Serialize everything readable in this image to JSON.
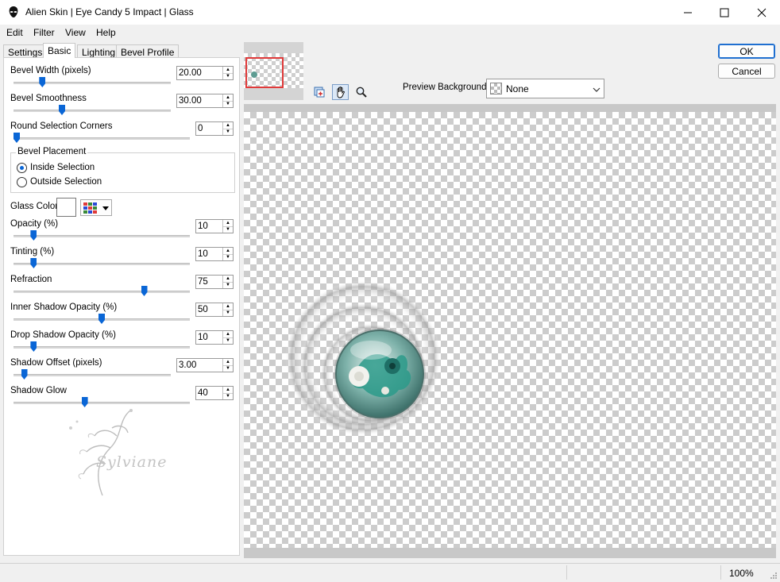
{
  "window": {
    "title": "Alien Skin | Eye Candy 5 Impact | Glass",
    "controls": {
      "minimize": "minimize-icon",
      "maximize": "maximize-icon",
      "close": "close-icon"
    }
  },
  "menu": {
    "items": [
      "Edit",
      "Filter",
      "View",
      "Help"
    ]
  },
  "tabs": [
    "Settings",
    "Basic",
    "Lighting",
    "Bevel Profile"
  ],
  "active_tab": "Basic",
  "controls": {
    "bevel_width": {
      "label": "Bevel Width (pixels)",
      "value": "20.00",
      "slider": 0.17
    },
    "bevel_smoothness": {
      "label": "Bevel Smoothness",
      "value": "30.00",
      "slider": 0.3
    },
    "round_corners": {
      "label": "Round Selection Corners",
      "value": "0",
      "slider": 0.0
    },
    "bevel_placement": {
      "label": "Bevel Placement",
      "options": [
        "Inside Selection",
        "Outside Selection"
      ],
      "selected": "Inside Selection"
    },
    "glass_color": {
      "label": "Glass Color",
      "swatch": "#ffffff"
    },
    "opacity": {
      "label": "Opacity (%)",
      "value": "10",
      "slider": 0.1
    },
    "tinting": {
      "label": "Tinting (%)",
      "value": "10",
      "slider": 0.1
    },
    "refraction": {
      "label": "Refraction",
      "value": "75",
      "slider": 0.75
    },
    "inner_shadow_opacity": {
      "label": "Inner Shadow Opacity (%)",
      "value": "50",
      "slider": 0.5
    },
    "drop_shadow_opacity": {
      "label": "Drop Shadow Opacity (%)",
      "value": "10",
      "slider": 0.1
    },
    "shadow_offset": {
      "label": "Shadow Offset (pixels)",
      "value": "3.00",
      "slider": 0.05
    },
    "shadow_glow": {
      "label": "Shadow Glow",
      "value": "40",
      "slider": 0.4
    }
  },
  "watermark": "Sylviane",
  "preview": {
    "bg_label": "Preview Background:",
    "bg_value": "None",
    "tools": [
      "preview-toggle-icon",
      "hand-pan-icon",
      "zoom-magnifier-icon"
    ]
  },
  "buttons": {
    "ok": "OK",
    "cancel": "Cancel"
  },
  "status": {
    "zoom": "100%"
  },
  "colors": {
    "accent": "#0a66d6",
    "frame": "#e03a3a",
    "teal": "#2b9a8a"
  }
}
